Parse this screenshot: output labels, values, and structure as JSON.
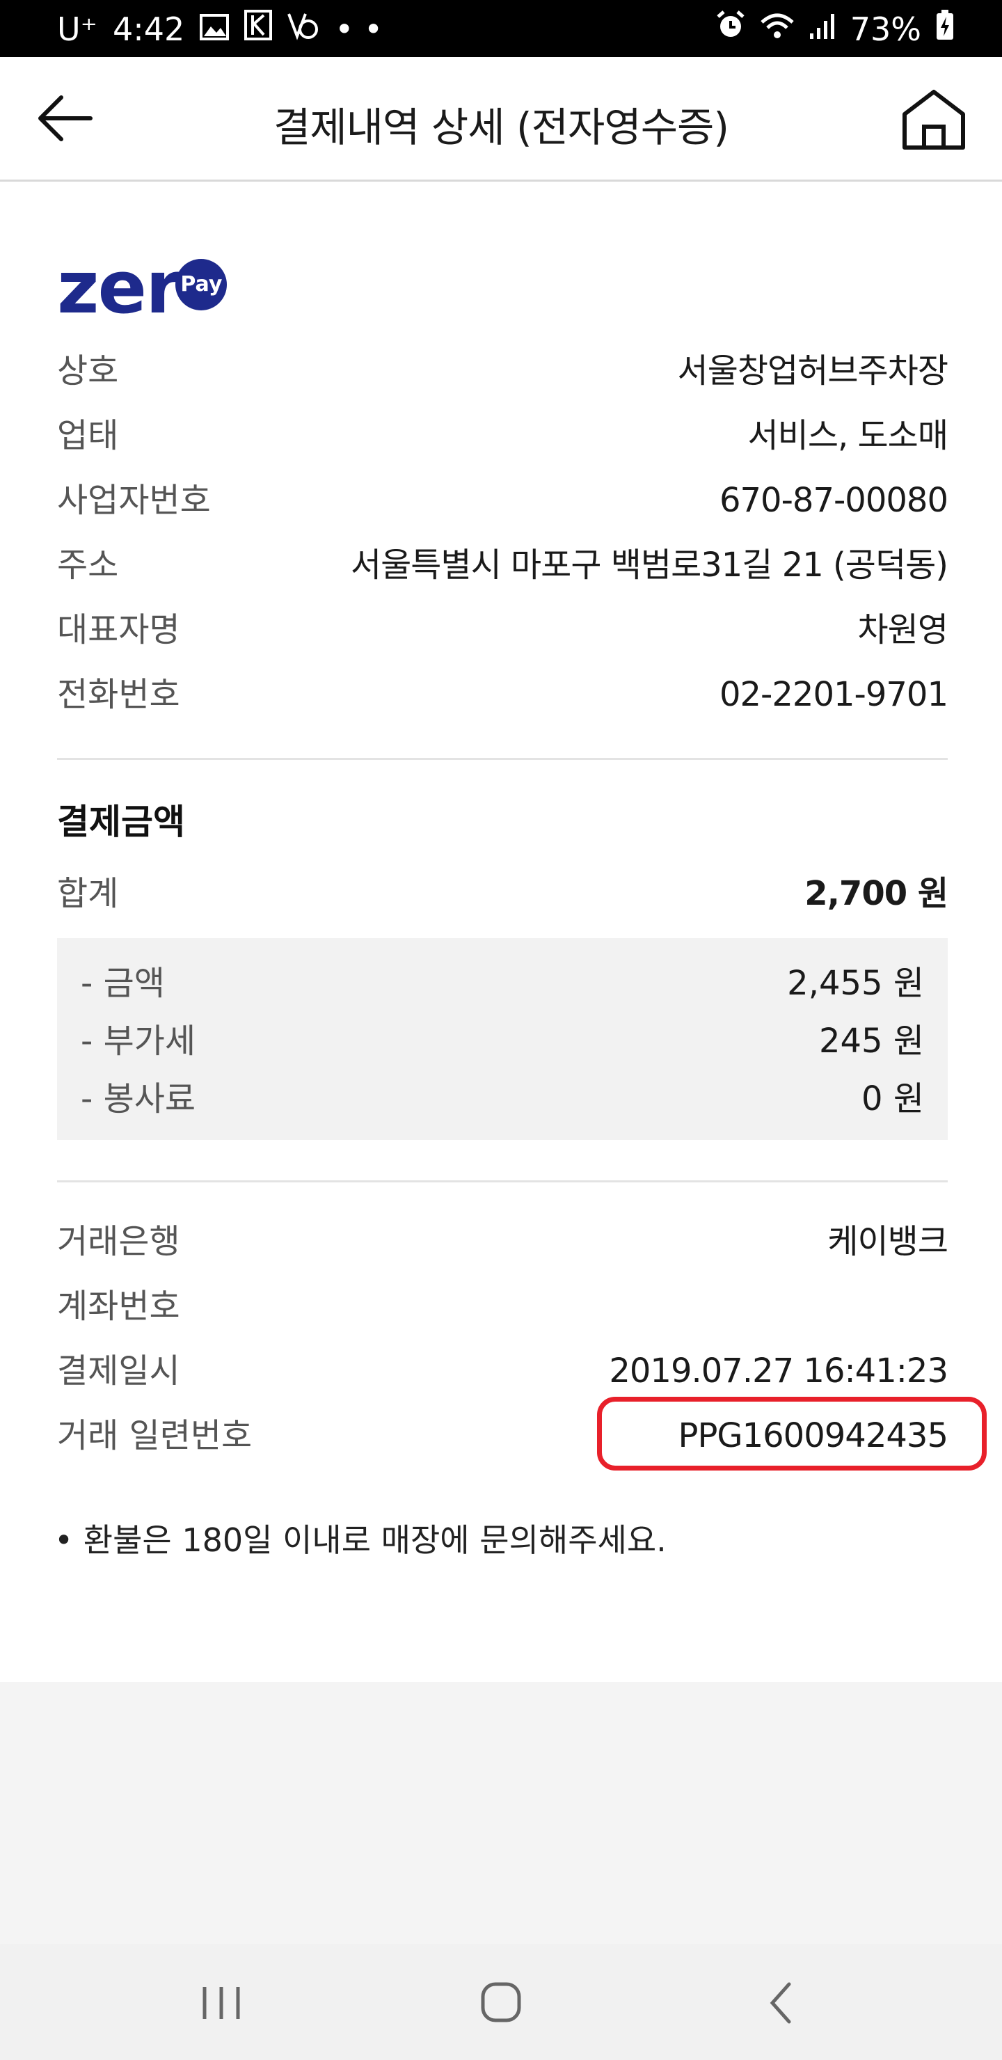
{
  "status_bar": {
    "carrier": "U⁺",
    "time": "4:42",
    "battery": "73%"
  },
  "app_bar": {
    "title": "결제내역 상세 (전자영수증)"
  },
  "logo": {
    "text": "zer",
    "badge": "Pay"
  },
  "merchant": [
    {
      "label": "상호",
      "value": "서울창업허브주차장"
    },
    {
      "label": "업태",
      "value": "서비스, 도소매"
    },
    {
      "label": "사업자번호",
      "value": "670-87-00080"
    },
    {
      "label": "주소",
      "value": "서울특별시 마포구 백범로31길 21 (공덕동)"
    },
    {
      "label": "대표자명",
      "value": "차원영"
    },
    {
      "label": "전화번호",
      "value": "02-2201-9701"
    }
  ],
  "payment": {
    "section_title": "결제금액",
    "total_label": "합계",
    "total_value": "2,700 원",
    "breakdown": [
      {
        "label": "- 금액",
        "value": "2,455 원"
      },
      {
        "label": "- 부가세",
        "value": "245 원"
      },
      {
        "label": "- 봉사료",
        "value": "0 원"
      }
    ]
  },
  "transaction": [
    {
      "label": "거래은행",
      "value": "케이뱅크"
    },
    {
      "label": "계좌번호",
      "value": ""
    },
    {
      "label": "결제일시",
      "value": "2019.07.27 16:41:23"
    },
    {
      "label": "거래 일련번호",
      "value": "PPG1600942435"
    }
  ],
  "notice": "• 환불은 180일 이내로 매장에 문의해주세요.",
  "colors": {
    "brand": "#1e2a8c",
    "highlight": "#e8202a"
  }
}
